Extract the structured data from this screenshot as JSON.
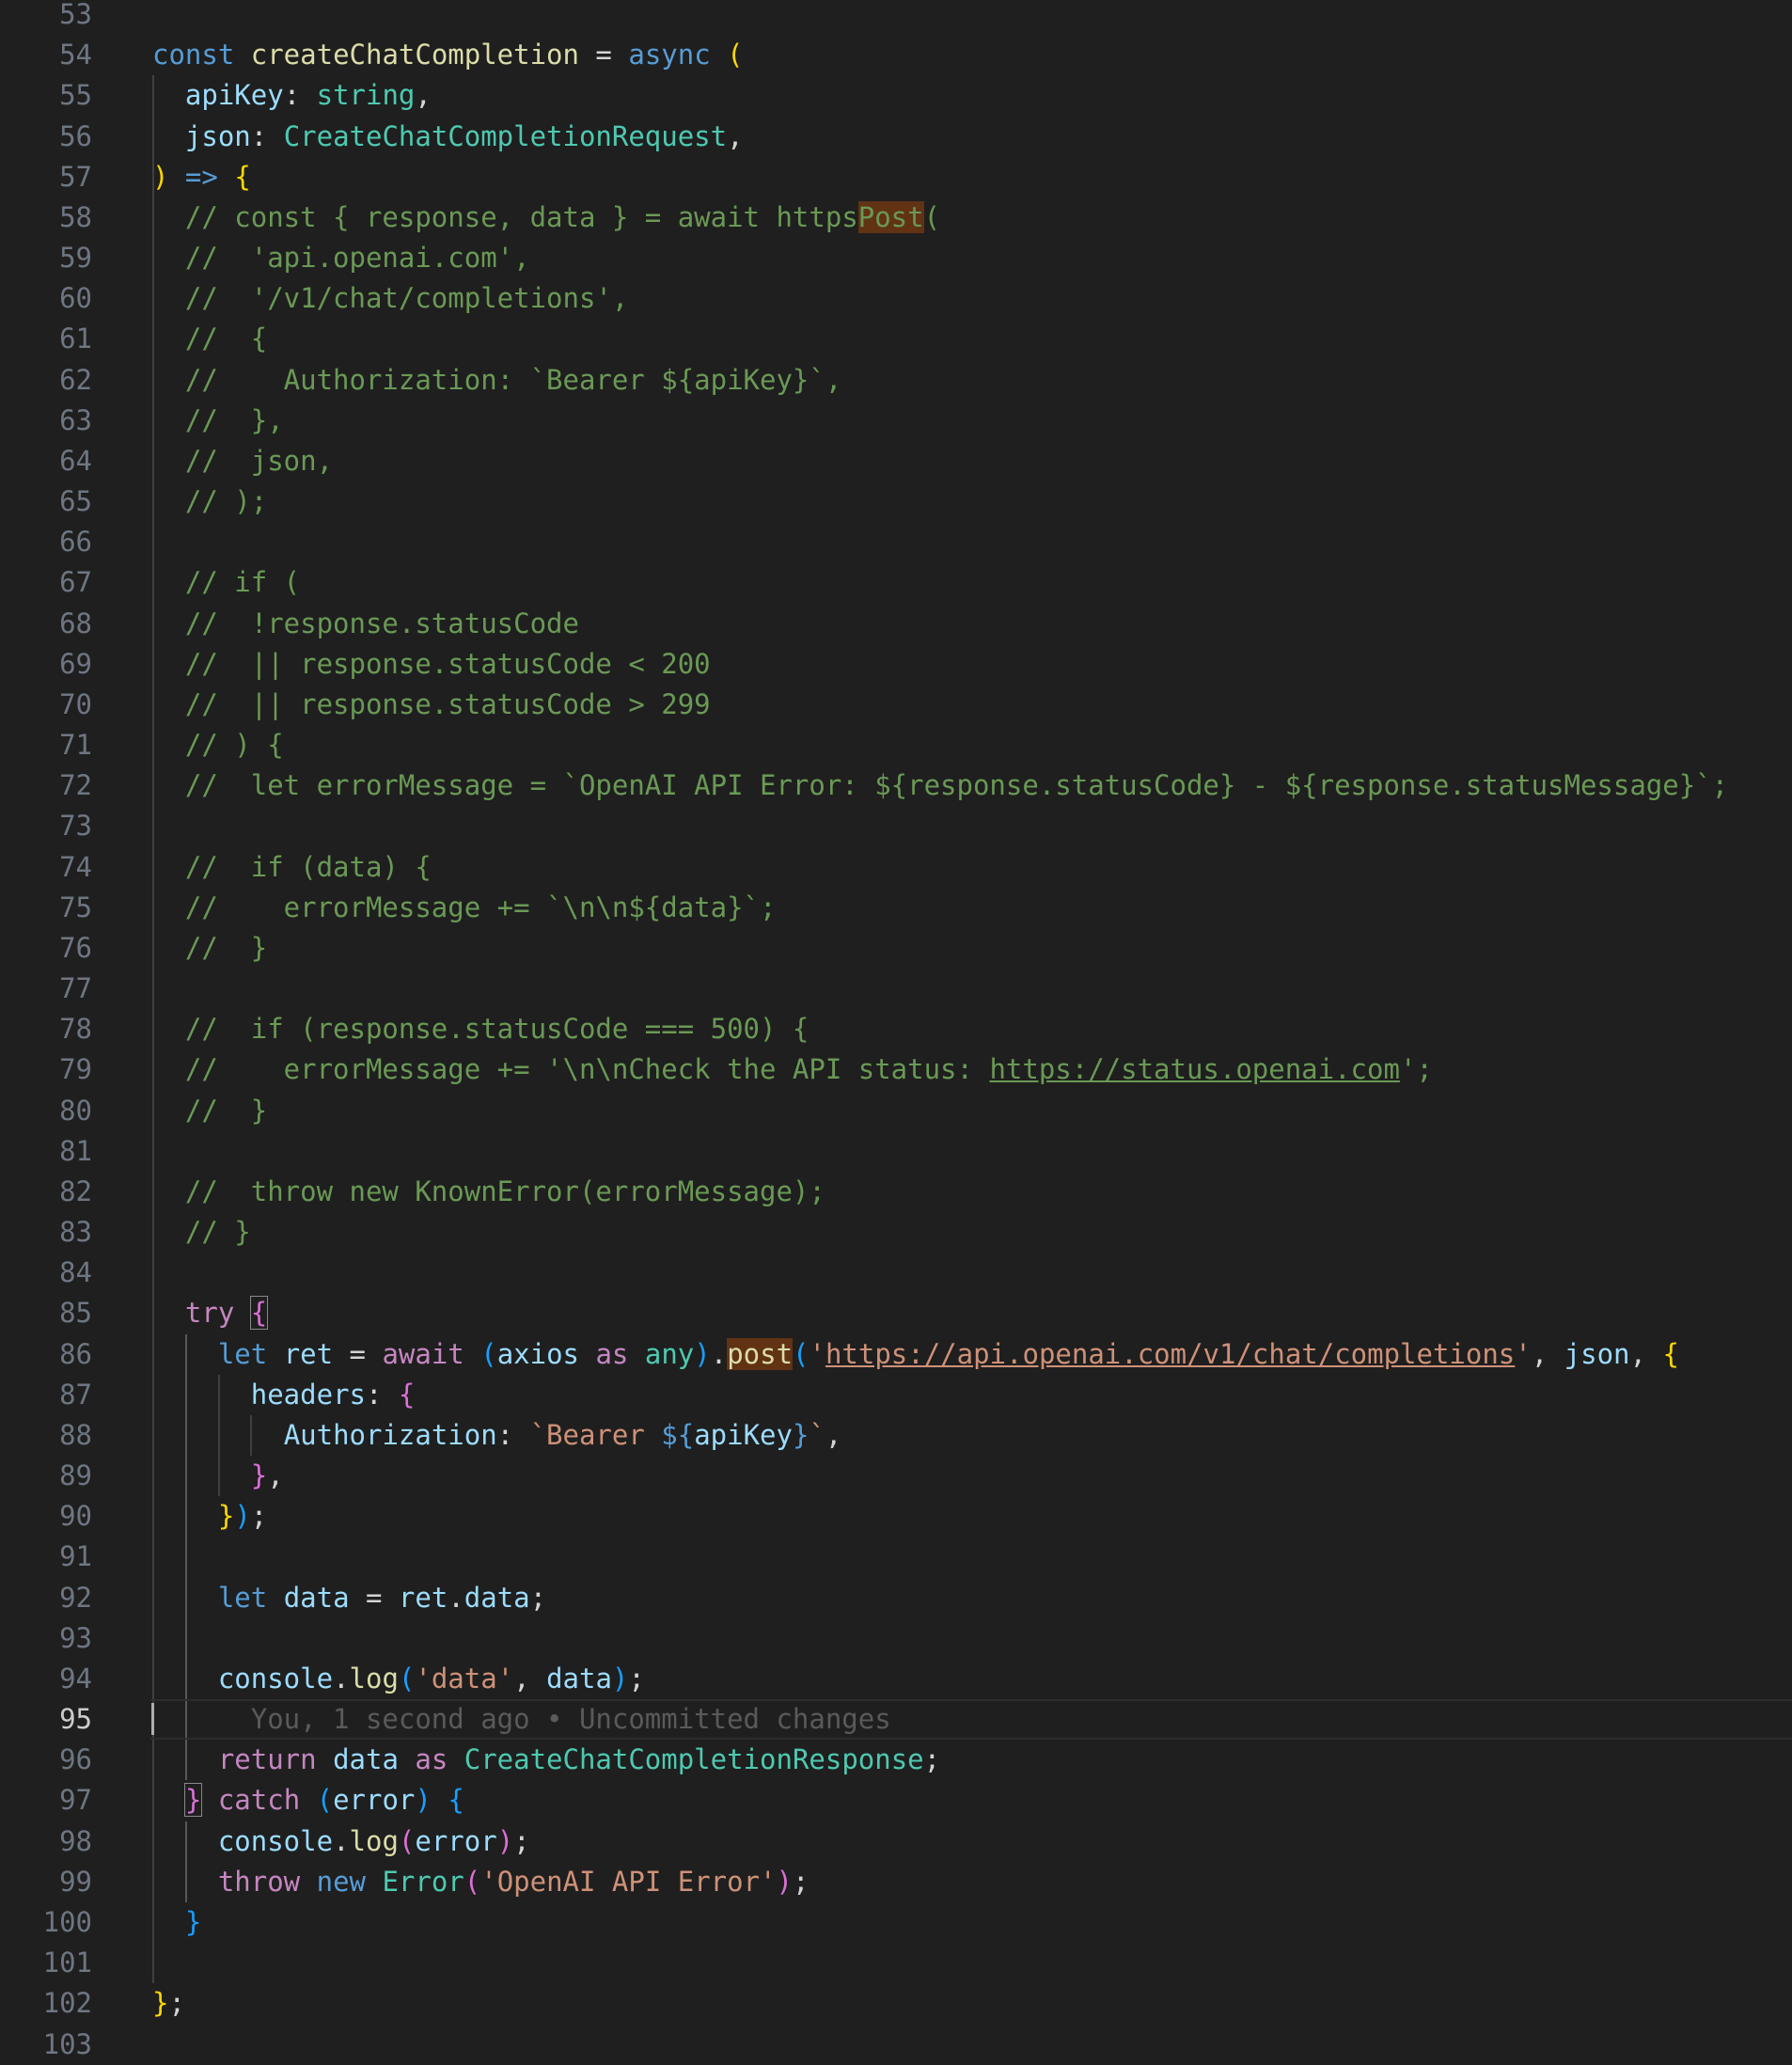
{
  "editor": {
    "active_line": "95",
    "lines": [
      {
        "n": "53",
        "t": []
      },
      {
        "n": "54",
        "t": [
          [
            "kw",
            "const "
          ],
          [
            "fn",
            "createChatCompletion"
          ],
          [
            "pl",
            " = "
          ],
          [
            "kw",
            "async "
          ],
          [
            "b1",
            "("
          ]
        ]
      },
      {
        "n": "55",
        "t": [
          [
            "pl",
            "  "
          ],
          [
            "var",
            "apiKey"
          ],
          [
            "pl",
            ": "
          ],
          [
            "ty",
            "string"
          ],
          [
            "pl",
            ","
          ]
        ]
      },
      {
        "n": "56",
        "t": [
          [
            "pl",
            "  "
          ],
          [
            "var",
            "json"
          ],
          [
            "pl",
            ": "
          ],
          [
            "ty",
            "CreateChatCompletionRequest"
          ],
          [
            "pl",
            ","
          ]
        ]
      },
      {
        "n": "57",
        "t": [
          [
            "b1",
            ")"
          ],
          [
            "kw",
            " => "
          ],
          [
            "b1",
            "{"
          ]
        ]
      },
      {
        "n": "58",
        "t": [
          [
            "cm",
            "  // const { response, data } = await https"
          ],
          [
            "cm hl",
            "Post"
          ],
          [
            "cm",
            "("
          ]
        ]
      },
      {
        "n": "59",
        "t": [
          [
            "cm",
            "  //  'api.openai.com',"
          ]
        ]
      },
      {
        "n": "60",
        "t": [
          [
            "cm",
            "  //  '/v1/chat/completions',"
          ]
        ]
      },
      {
        "n": "61",
        "t": [
          [
            "cm",
            "  //  {"
          ]
        ]
      },
      {
        "n": "62",
        "t": [
          [
            "cm",
            "  //    Authorization: `Bearer ${apiKey}`,"
          ]
        ]
      },
      {
        "n": "63",
        "t": [
          [
            "cm",
            "  //  },"
          ]
        ]
      },
      {
        "n": "64",
        "t": [
          [
            "cm",
            "  //  json,"
          ]
        ]
      },
      {
        "n": "65",
        "t": [
          [
            "cm",
            "  // );"
          ]
        ]
      },
      {
        "n": "66",
        "t": []
      },
      {
        "n": "67",
        "t": [
          [
            "cm",
            "  // if ("
          ]
        ]
      },
      {
        "n": "68",
        "t": [
          [
            "cm",
            "  //  !response.statusCode"
          ]
        ]
      },
      {
        "n": "69",
        "t": [
          [
            "cm",
            "  //  || response.statusCode < 200"
          ]
        ]
      },
      {
        "n": "70",
        "t": [
          [
            "cm",
            "  //  || response.statusCode > 299"
          ]
        ]
      },
      {
        "n": "71",
        "t": [
          [
            "cm",
            "  // ) {"
          ]
        ]
      },
      {
        "n": "72",
        "t": [
          [
            "cm",
            "  //  let errorMessage = `OpenAI API Error: ${response.statusCode} - ${response.statusMessage}`;"
          ]
        ]
      },
      {
        "n": "73",
        "t": []
      },
      {
        "n": "74",
        "t": [
          [
            "cm",
            "  //  if (data) {"
          ]
        ]
      },
      {
        "n": "75",
        "t": [
          [
            "cm",
            "  //    errorMessage += `\\n\\n${data}`;"
          ]
        ]
      },
      {
        "n": "76",
        "t": [
          [
            "cm",
            "  //  }"
          ]
        ]
      },
      {
        "n": "77",
        "t": []
      },
      {
        "n": "78",
        "t": [
          [
            "cm",
            "  //  if (response.statusCode === 500) {"
          ]
        ]
      },
      {
        "n": "79",
        "t": [
          [
            "cm",
            "  //    errorMessage += '\\n\\nCheck the API status: "
          ],
          [
            "cm lnk",
            "https://status.openai.com"
          ],
          [
            "cm",
            "';"
          ]
        ]
      },
      {
        "n": "80",
        "t": [
          [
            "cm",
            "  //  }"
          ]
        ]
      },
      {
        "n": "81",
        "t": []
      },
      {
        "n": "82",
        "t": [
          [
            "cm",
            "  //  throw new KnownError(errorMessage);"
          ]
        ]
      },
      {
        "n": "83",
        "t": [
          [
            "cm",
            "  // }"
          ]
        ]
      },
      {
        "n": "84",
        "t": []
      },
      {
        "n": "85",
        "t": [
          [
            "pl",
            "  "
          ],
          [
            "kc",
            "try "
          ],
          [
            "b2 bm",
            "{"
          ]
        ]
      },
      {
        "n": "86",
        "t": [
          [
            "pl",
            "    "
          ],
          [
            "kw",
            "let "
          ],
          [
            "var",
            "ret"
          ],
          [
            "pl",
            " = "
          ],
          [
            "kc",
            "await "
          ],
          [
            "b3",
            "("
          ],
          [
            "var",
            "axios"
          ],
          [
            "kc",
            " as "
          ],
          [
            "ty",
            "any"
          ],
          [
            "b3",
            ")"
          ],
          [
            "pl",
            "."
          ],
          [
            "fn hl",
            "post"
          ],
          [
            "b3",
            "("
          ],
          [
            "str",
            "'"
          ],
          [
            "str lnk",
            "https://api.openai.com/v1/chat/completions"
          ],
          [
            "str",
            "'"
          ],
          [
            "pl",
            ", "
          ],
          [
            "var",
            "json"
          ],
          [
            "pl",
            ", "
          ],
          [
            "b1",
            "{"
          ]
        ]
      },
      {
        "n": "87",
        "t": [
          [
            "pl",
            "      "
          ],
          [
            "var",
            "headers"
          ],
          [
            "pl",
            ": "
          ],
          [
            "b2",
            "{"
          ]
        ]
      },
      {
        "n": "88",
        "t": [
          [
            "pl",
            "        "
          ],
          [
            "var",
            "Authorization"
          ],
          [
            "pl",
            ": "
          ],
          [
            "str",
            "`Bearer "
          ],
          [
            "kw",
            "${"
          ],
          [
            "var",
            "apiKey"
          ],
          [
            "kw",
            "}"
          ],
          [
            "str",
            "`"
          ],
          [
            "pl",
            ","
          ]
        ]
      },
      {
        "n": "89",
        "t": [
          [
            "pl",
            "      "
          ],
          [
            "b2",
            "}"
          ],
          [
            "pl",
            ","
          ]
        ]
      },
      {
        "n": "90",
        "t": [
          [
            "pl",
            "    "
          ],
          [
            "b1",
            "}"
          ],
          [
            "b3",
            ")"
          ],
          [
            "pl",
            ";"
          ]
        ]
      },
      {
        "n": "91",
        "t": []
      },
      {
        "n": "92",
        "t": [
          [
            "pl",
            "    "
          ],
          [
            "kw",
            "let "
          ],
          [
            "var",
            "data"
          ],
          [
            "pl",
            " = "
          ],
          [
            "var",
            "ret"
          ],
          [
            "pl",
            "."
          ],
          [
            "var",
            "data"
          ],
          [
            "pl",
            ";"
          ]
        ]
      },
      {
        "n": "93",
        "t": []
      },
      {
        "n": "94",
        "t": [
          [
            "pl",
            "    "
          ],
          [
            "var",
            "console"
          ],
          [
            "pl",
            "."
          ],
          [
            "fn",
            "log"
          ],
          [
            "b3",
            "("
          ],
          [
            "str",
            "'data'"
          ],
          [
            "pl",
            ", "
          ],
          [
            "var",
            "data"
          ],
          [
            "b3",
            ")"
          ],
          [
            "pl",
            ";"
          ]
        ]
      },
      {
        "n": "95",
        "t": [
          [
            "ghost",
            "      You, 1 second ago • Uncommitted changes"
          ]
        ]
      },
      {
        "n": "96",
        "t": [
          [
            "pl",
            "    "
          ],
          [
            "kc",
            "return "
          ],
          [
            "var",
            "data"
          ],
          [
            "kc",
            " as "
          ],
          [
            "ty",
            "CreateChatCompletionResponse"
          ],
          [
            "pl",
            ";"
          ]
        ]
      },
      {
        "n": "97",
        "t": [
          [
            "pl",
            "  "
          ],
          [
            "b2 bm",
            "}"
          ],
          [
            "kc",
            " catch "
          ],
          [
            "b3",
            "("
          ],
          [
            "var",
            "error"
          ],
          [
            "b3",
            ")"
          ],
          [
            "pl",
            " "
          ],
          [
            "b3",
            "{"
          ]
        ]
      },
      {
        "n": "98",
        "t": [
          [
            "pl",
            "    "
          ],
          [
            "var",
            "console"
          ],
          [
            "pl",
            "."
          ],
          [
            "fn",
            "log"
          ],
          [
            "b2",
            "("
          ],
          [
            "var",
            "error"
          ],
          [
            "b2",
            ")"
          ],
          [
            "pl",
            ";"
          ]
        ]
      },
      {
        "n": "99",
        "t": [
          [
            "pl",
            "    "
          ],
          [
            "kc",
            "throw "
          ],
          [
            "kw",
            "new "
          ],
          [
            "ty",
            "Error"
          ],
          [
            "b2",
            "("
          ],
          [
            "str",
            "'OpenAI API Error'"
          ],
          [
            "b2",
            ")"
          ],
          [
            "pl",
            ";"
          ]
        ]
      },
      {
        "n": "100",
        "t": [
          [
            "pl",
            "  "
          ],
          [
            "b3",
            "}"
          ]
        ]
      },
      {
        "n": "101",
        "t": []
      },
      {
        "n": "102",
        "t": [
          [
            "b1",
            "}"
          ],
          [
            "pl",
            ";"
          ]
        ]
      },
      {
        "n": "103",
        "t": []
      }
    ]
  }
}
